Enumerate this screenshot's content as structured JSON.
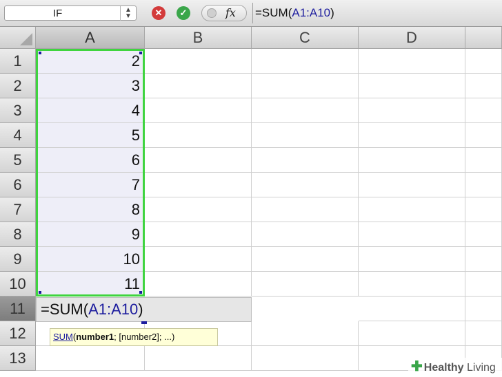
{
  "formula_bar": {
    "name_box": "IF",
    "stepper_glyph": "▲▼",
    "cancel_glyph": "✕",
    "enter_glyph": "✓",
    "fx_label": "fx",
    "formula_prefix": "=SUM(",
    "formula_ref": "A1:A10",
    "formula_suffix": ")"
  },
  "columns": [
    "A",
    "B",
    "C",
    "D"
  ],
  "rows": [
    "1",
    "2",
    "3",
    "4",
    "5",
    "6",
    "7",
    "8",
    "9",
    "10",
    "11",
    "12",
    "13"
  ],
  "cells_a": [
    "2",
    "3",
    "4",
    "5",
    "6",
    "7",
    "8",
    "9",
    "10",
    "11"
  ],
  "editing": {
    "prefix": "=SUM(",
    "ref": "A1:A10",
    "suffix": ")"
  },
  "tooltip": {
    "fn": "SUM",
    "open": "(",
    "arg1": "number1",
    "rest": "; [number2]; ...)"
  },
  "watermark": {
    "plus": "✚",
    "healthy": "Healthy",
    "living": " Living"
  },
  "colors": {
    "range_border": "#3fd43f",
    "reference_blue": "#1d1d9e",
    "cancel_red": "#d33a3a",
    "enter_green": "#3aa64a",
    "tooltip_bg": "#ffffd8"
  },
  "icons": {
    "cancel": "cancel-icon",
    "enter": "checkmark-icon",
    "function": "fx-icon",
    "stepper": "stepper-icon"
  }
}
